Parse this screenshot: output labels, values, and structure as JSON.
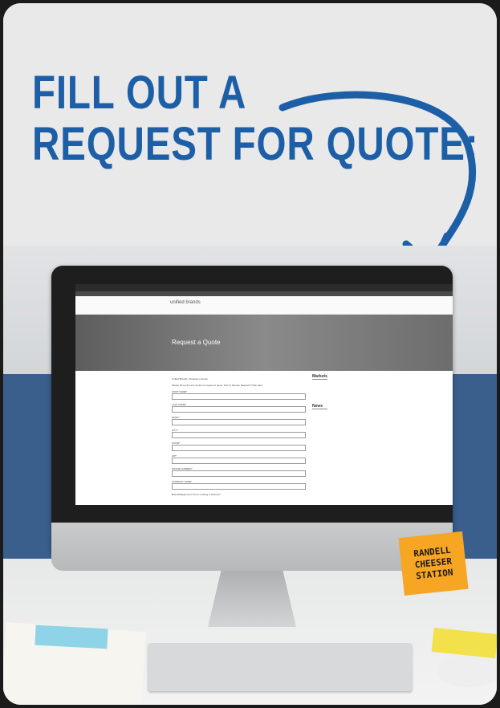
{
  "headline": "FILL OUT A\nREQUEST FOR QUOTE:",
  "colors": {
    "headline": "#1d5fa6",
    "note": "#f6a623"
  },
  "screen": {
    "brand": "unified brands",
    "hero_title": "Request a Quote",
    "breadcrumb": "Unified Brands / Request a Quote",
    "intro": "Please fill out the form below to request a quote. Part or Service Request? Click Here.",
    "fields": [
      "FIRST NAME*",
      "LAST NAME*",
      "EMAIL*",
      "CITY*",
      "STATE*",
      "ZIP*",
      "PHONE NUMBER*",
      "COMPANY NAME*"
    ],
    "brands_label": "Brands/Equipment You're Looking to Discuss*",
    "sidebar_markets": "Markets",
    "sidebar_news": "News"
  },
  "note": "RANDELL\nCHEESER\nSTATION"
}
